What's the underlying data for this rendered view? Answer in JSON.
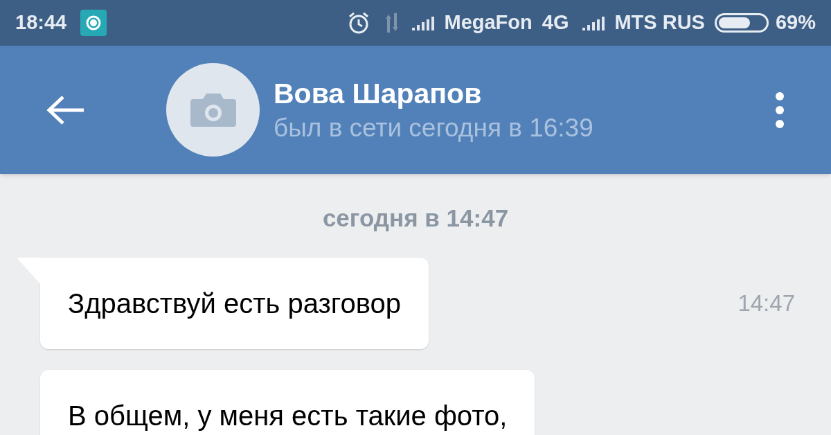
{
  "status_bar": {
    "time": "18:44",
    "carriers": [
      {
        "name": "MegaFon",
        "network": "4G"
      },
      {
        "name": "MTS RUS"
      }
    ],
    "battery": {
      "level": 0.69,
      "percent": "69%"
    }
  },
  "header": {
    "name": "Вова Шарапов",
    "last_seen": "был в сети сегодня в 16:39"
  },
  "date_separator": "сегодня в 14:47",
  "messages": [
    {
      "text": "Здравствуй есть разговор",
      "time": "14:47",
      "first_in_group": true
    },
    {
      "text": "В общем, у меня есть такие фото,",
      "first_in_group": false
    }
  ]
}
